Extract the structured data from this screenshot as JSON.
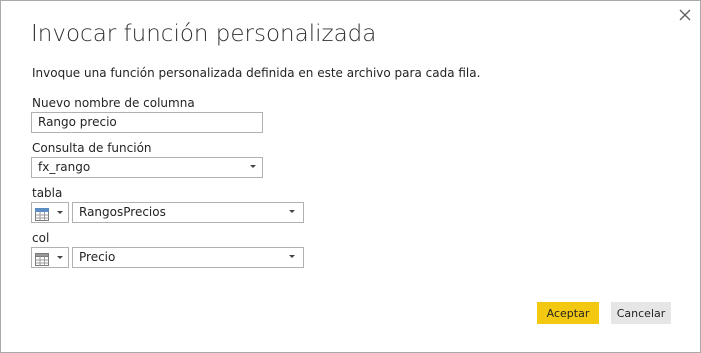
{
  "dialog": {
    "title": "Invocar función personalizada",
    "description": "Invoque una función personalizada definida en este archivo para cada fila."
  },
  "new_column": {
    "label": "Nuevo nombre de columna",
    "value": "Rango precio"
  },
  "function_query": {
    "label": "Consulta de función",
    "selected": "fx_rango"
  },
  "params": [
    {
      "label": "tabla",
      "type_icon": "table-icon",
      "selected": "RangosPrecios"
    },
    {
      "label": "col",
      "type_icon": "column-icon",
      "selected": "Precio"
    }
  ],
  "buttons": {
    "ok": "Aceptar",
    "cancel": "Cancelar"
  },
  "colors": {
    "accent": "#f2c811",
    "secondary_button": "#e6e6e6",
    "border": "#b3b0ad"
  }
}
